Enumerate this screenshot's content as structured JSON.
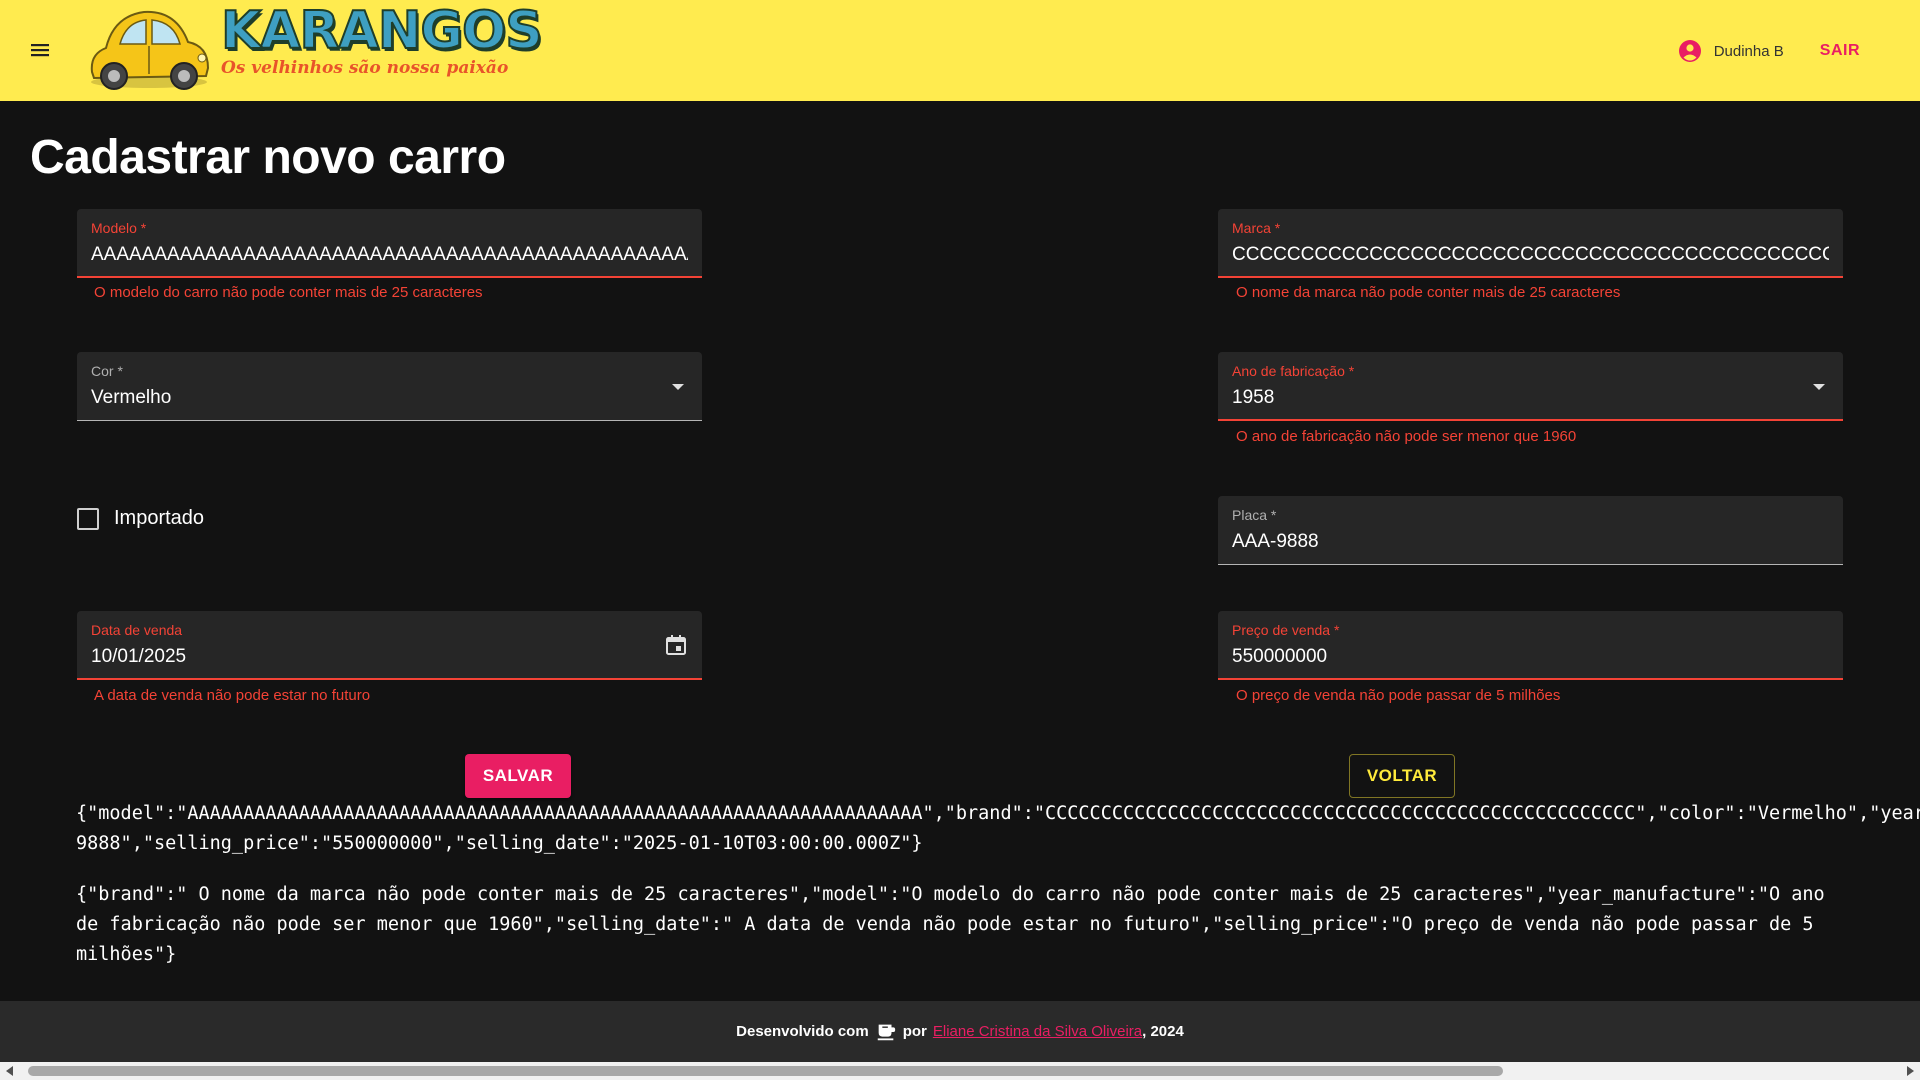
{
  "header": {
    "logo_title": "KARANGOS",
    "logo_slogan": "Os velhinhos são nossa paixão",
    "user_name": "Dudinha B",
    "logout_label": "SAIR",
    "brand_color": "#ffeb4f",
    "accent_color": "#e91e63"
  },
  "page": {
    "title": "Cadastrar novo carro"
  },
  "form": {
    "model": {
      "label": "Modelo *",
      "value": "AAAAAAAAAAAAAAAAAAAAAAAAAAAAAAAAAAAAAAAAAAAAAAAAAAAAAAAAAAAAAAAAAA",
      "error": "O modelo do carro não pode conter mais de 25 caracteres"
    },
    "brand": {
      "label": "Marca *",
      "value": "CCCCCCCCCCCCCCCCCCCCCCCCCCCCCCCCCCCCCCCCCCCCCCCCCCCCC",
      "error": "O nome da marca não pode conter mais de 25 caracteres"
    },
    "color": {
      "label": "Cor *",
      "value": "Vermelho",
      "icon": "chevron-down-icon"
    },
    "year": {
      "label": "Ano de fabricação *",
      "value": "1958",
      "error": "O ano de fabricação não pode ser menor que 1960",
      "icon": "chevron-down-icon"
    },
    "imported": {
      "label": "Importado",
      "checked": false
    },
    "plate": {
      "label": "Placa *",
      "value": "AAA-9888"
    },
    "selling_date": {
      "label": "Data de venda",
      "value": "10/01/2025",
      "error": "A data de venda não pode estar no futuro",
      "icon": "calendar-icon"
    },
    "selling_price": {
      "label": "Preço de venda *",
      "value": "550000000",
      "error": "O preço de venda não pode passar de 5 milhões"
    },
    "save_label": "SALVAR",
    "back_label": "VOLTAR",
    "error_color": "#f44336"
  },
  "debug": {
    "values_line1": "{\"model\":\"AAAAAAAAAAAAAAAAAAAAAAAAAAAAAAAAAAAAAAAAAAAAAAAAAAAAAAAAAAAAAAAAAA\",\"brand\":\"CCCCCCCCCCCCCCCCCCCCCCCCCCCCCCCCCCCCCCCCCCCCCCCCCCCCC\",\"color\":\"Vermelho\",\"year_manu",
    "values_line2": "9888\",\"selling_price\":\"550000000\",\"selling_date\":\"2025-01-10T03:00:00.000Z\"}",
    "errors": "{\"brand\":\" O nome da marca não pode conter mais de 25 caracteres\",\"model\":\"O modelo do carro não pode conter mais de 25 caracteres\",\"year_manufacture\":\"O ano de fabricação não pode ser menor que 1960\",\"selling_date\":\" A data de venda não pode estar no futuro\",\"selling_price\":\"O preço de venda não pode passar de 5 milhões\"}"
  },
  "footer": {
    "prefix": "Desenvolvido com",
    "middle": "por",
    "author": "Eliane Cristina da Silva Oliveira",
    "suffix": ", 2024",
    "icon": "coffee-icon"
  }
}
